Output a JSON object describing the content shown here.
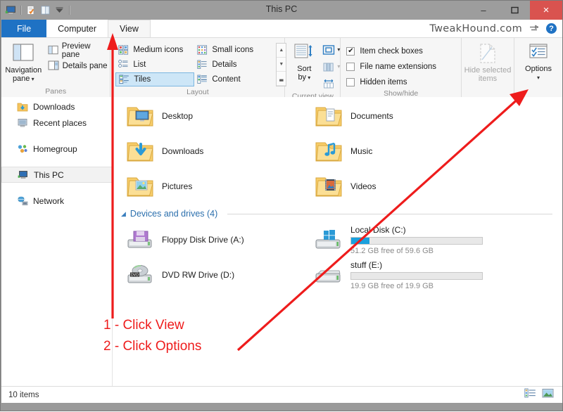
{
  "window": {
    "title": "This PC",
    "minimize_label": "–",
    "maximize_label": "❐",
    "close_label": "×"
  },
  "quick_access": {
    "icons": [
      "this-pc-icon",
      "properties-icon",
      "new-folder-icon",
      "customize-dropdown-icon"
    ]
  },
  "tabs": [
    {
      "label": "File",
      "key": "file"
    },
    {
      "label": "Computer",
      "key": "computer"
    },
    {
      "label": "View",
      "key": "view"
    }
  ],
  "branding": {
    "watermark": "TweakHound.com",
    "help_label": "?"
  },
  "ribbon": {
    "groups": [
      {
        "label": "Panes",
        "big_button": {
          "line1": "Navigation",
          "line2": "pane",
          "has_caret": true
        },
        "items": [
          {
            "label": "Preview pane"
          },
          {
            "label": "Details pane"
          }
        ]
      },
      {
        "label": "Layout",
        "gallery_left": [
          {
            "label": "Medium icons",
            "selected": false
          },
          {
            "label": "List",
            "selected": false
          },
          {
            "label": "Tiles",
            "selected": true
          }
        ],
        "gallery_right": [
          {
            "label": "Small icons",
            "selected": false
          },
          {
            "label": "Details",
            "selected": false
          },
          {
            "label": "Content",
            "selected": false
          }
        ],
        "scroll_glyphs": [
          "▲",
          "▼",
          "▃"
        ]
      },
      {
        "label": "Current view",
        "sort_button": {
          "line1": "Sort",
          "line2": "by",
          "has_caret": true
        },
        "small_buttons": [
          "group-by-icon",
          "add-columns-icon",
          "size-all-columns-icon"
        ]
      },
      {
        "label": "Show/hide",
        "checkboxes": [
          {
            "label": "Item check boxes",
            "checked": true
          },
          {
            "label": "File name extensions",
            "checked": false
          },
          {
            "label": "Hidden items",
            "checked": false
          }
        ],
        "hide_selected": {
          "line1": "Hide selected",
          "line2": "items",
          "disabled": true
        },
        "options": {
          "line1": "Options",
          "has_caret": true
        }
      }
    ]
  },
  "sidebar": {
    "items": [
      {
        "label": "Downloads",
        "icon": "downloads-folder-icon",
        "selected": false,
        "clipped": true
      },
      {
        "label": "Recent places",
        "icon": "recent-places-icon",
        "selected": false
      },
      {
        "label": "Homegroup",
        "icon": "homegroup-icon",
        "selected": false,
        "gap_before": true
      },
      {
        "label": "This PC",
        "icon": "this-pc-icon",
        "selected": true,
        "gap_before": true
      },
      {
        "label": "Network",
        "icon": "network-icon",
        "selected": false,
        "gap_before": true
      }
    ]
  },
  "content": {
    "folders": [
      {
        "label": "Desktop",
        "icon": "desktop-folder-icon"
      },
      {
        "label": "Documents",
        "icon": "documents-folder-icon"
      },
      {
        "label": "Downloads",
        "icon": "downloads-folder-icon"
      },
      {
        "label": "Music",
        "icon": "music-folder-icon"
      },
      {
        "label": "Pictures",
        "icon": "pictures-folder-icon"
      },
      {
        "label": "Videos",
        "icon": "videos-folder-icon"
      }
    ],
    "section": {
      "title": "Devices and drives (4)",
      "expanded": true
    },
    "drives": [
      {
        "label": "Floppy Disk Drive (A:)",
        "icon": "floppy-drive-icon",
        "has_bar": false
      },
      {
        "label": "Local Disk (C:)",
        "icon": "windows-drive-icon",
        "has_bar": true,
        "used_percent": 14,
        "free_text": "51.2 GB free of 59.6 GB",
        "bar_color": "#1aa0dd"
      },
      {
        "label": "DVD RW Drive (D:)",
        "icon": "dvd-drive-icon",
        "has_bar": false
      },
      {
        "label": "stuff (E:)",
        "icon": "hard-drive-icon",
        "has_bar": true,
        "used_percent": 0,
        "free_text": "19.9 GB free of 19.9 GB",
        "bar_color": "#1aa0dd"
      }
    ]
  },
  "status_bar": {
    "item_count": "10 items",
    "view_buttons": [
      "details-view-icon",
      "large-icons-view-icon"
    ]
  },
  "annotations": {
    "step1": "1 - Click View",
    "step2": "2 - Click Options",
    "color": "#ee1c1c"
  }
}
